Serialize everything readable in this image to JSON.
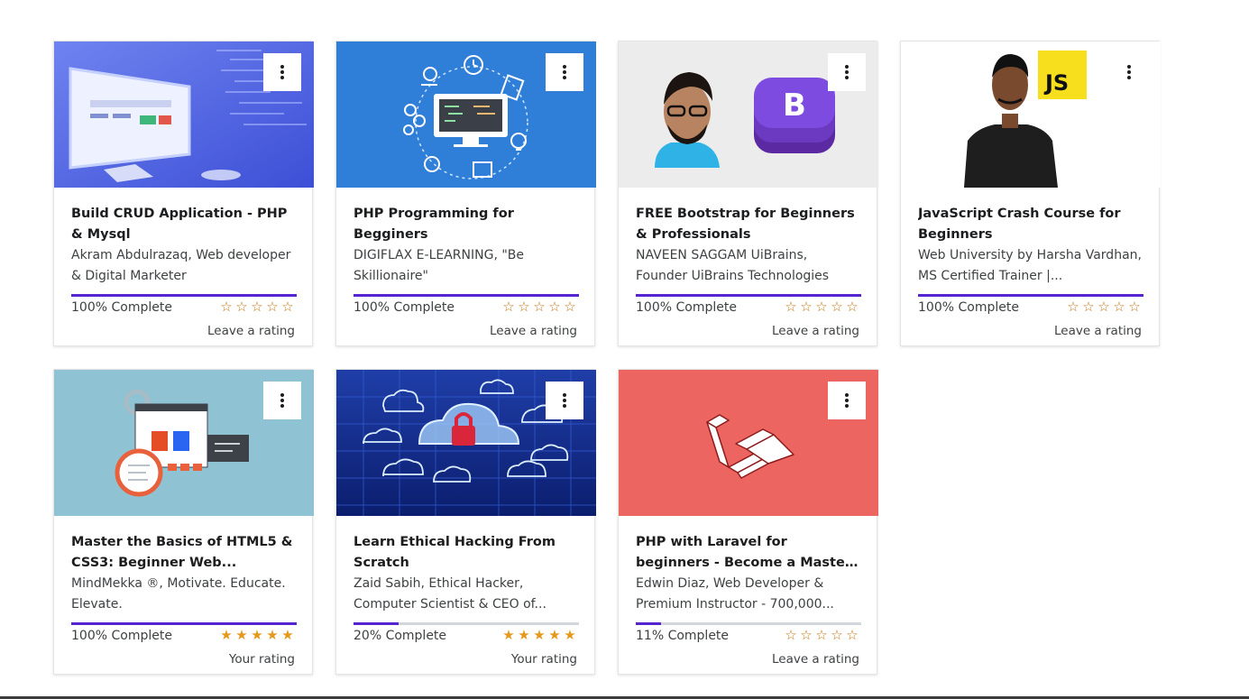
{
  "courses": [
    {
      "title": "Build CRUD Application - PHP & Mysql",
      "instructor": "Akram Abdulrazaq, Web developer & Digital Marketer",
      "progress_percent": 100,
      "complete_text": "100% Complete",
      "rating_label": "Leave a rating",
      "rating_filled": 0,
      "thumb": "monitor-code"
    },
    {
      "title": "PHP Programming for Begginers",
      "instructor": "DIGIFLAX E-LEARNING, \"Be Skillionaire\"",
      "progress_percent": 100,
      "complete_text": "100% Complete",
      "rating_label": "Leave a rating",
      "rating_filled": 0,
      "thumb": "blue-computer-icons"
    },
    {
      "title": "FREE Bootstrap for Beginners & Professionals",
      "instructor": "NAVEEN SAGGAM UiBrains, Founder UiBrains Technologies",
      "progress_percent": 100,
      "complete_text": "100% Complete",
      "rating_label": "Leave a rating",
      "rating_filled": 0,
      "thumb": "instructor-bootstrap-logo"
    },
    {
      "title": "JavaScript Crash Course for Beginners",
      "instructor": "Web University by Harsha Vardhan, MS Certified Trainer |...",
      "progress_percent": 100,
      "complete_text": "100% Complete",
      "rating_label": "Leave a rating",
      "rating_filled": 0,
      "thumb": "instructor-js-logo",
      "logo_text": "JS"
    },
    {
      "title": "Master the Basics of HTML5 & CSS3: Beginner Web...",
      "instructor": "MindMekka ®, Motivate. Educate. Elevate.",
      "progress_percent": 100,
      "complete_text": "100% Complete",
      "rating_label": "Your rating",
      "rating_filled": 5,
      "thumb": "html-css-illustration"
    },
    {
      "title": "Learn Ethical Hacking From Scratch",
      "instructor": "Zaid Sabih, Ethical Hacker, Computer Scientist & CEO of...",
      "progress_percent": 20,
      "complete_text": "20% Complete",
      "rating_label": "Your rating",
      "rating_filled": 5,
      "thumb": "cloud-security"
    },
    {
      "title": "PHP with Laravel for beginners - Become a Master in Laravel",
      "instructor": "Edwin Diaz, Web Developer & Premium Instructor - 700,000...",
      "progress_percent": 11,
      "complete_text": "11% Complete",
      "rating_label": "Leave a rating",
      "rating_filled": 0,
      "thumb": "laravel-logo"
    }
  ],
  "colors": {
    "progress_fill": "#5624d0",
    "progress_track": "#d1d7dc",
    "star": "#e59819"
  },
  "icons": {
    "menu": "more-vertical-icon",
    "star": "star-icon"
  }
}
